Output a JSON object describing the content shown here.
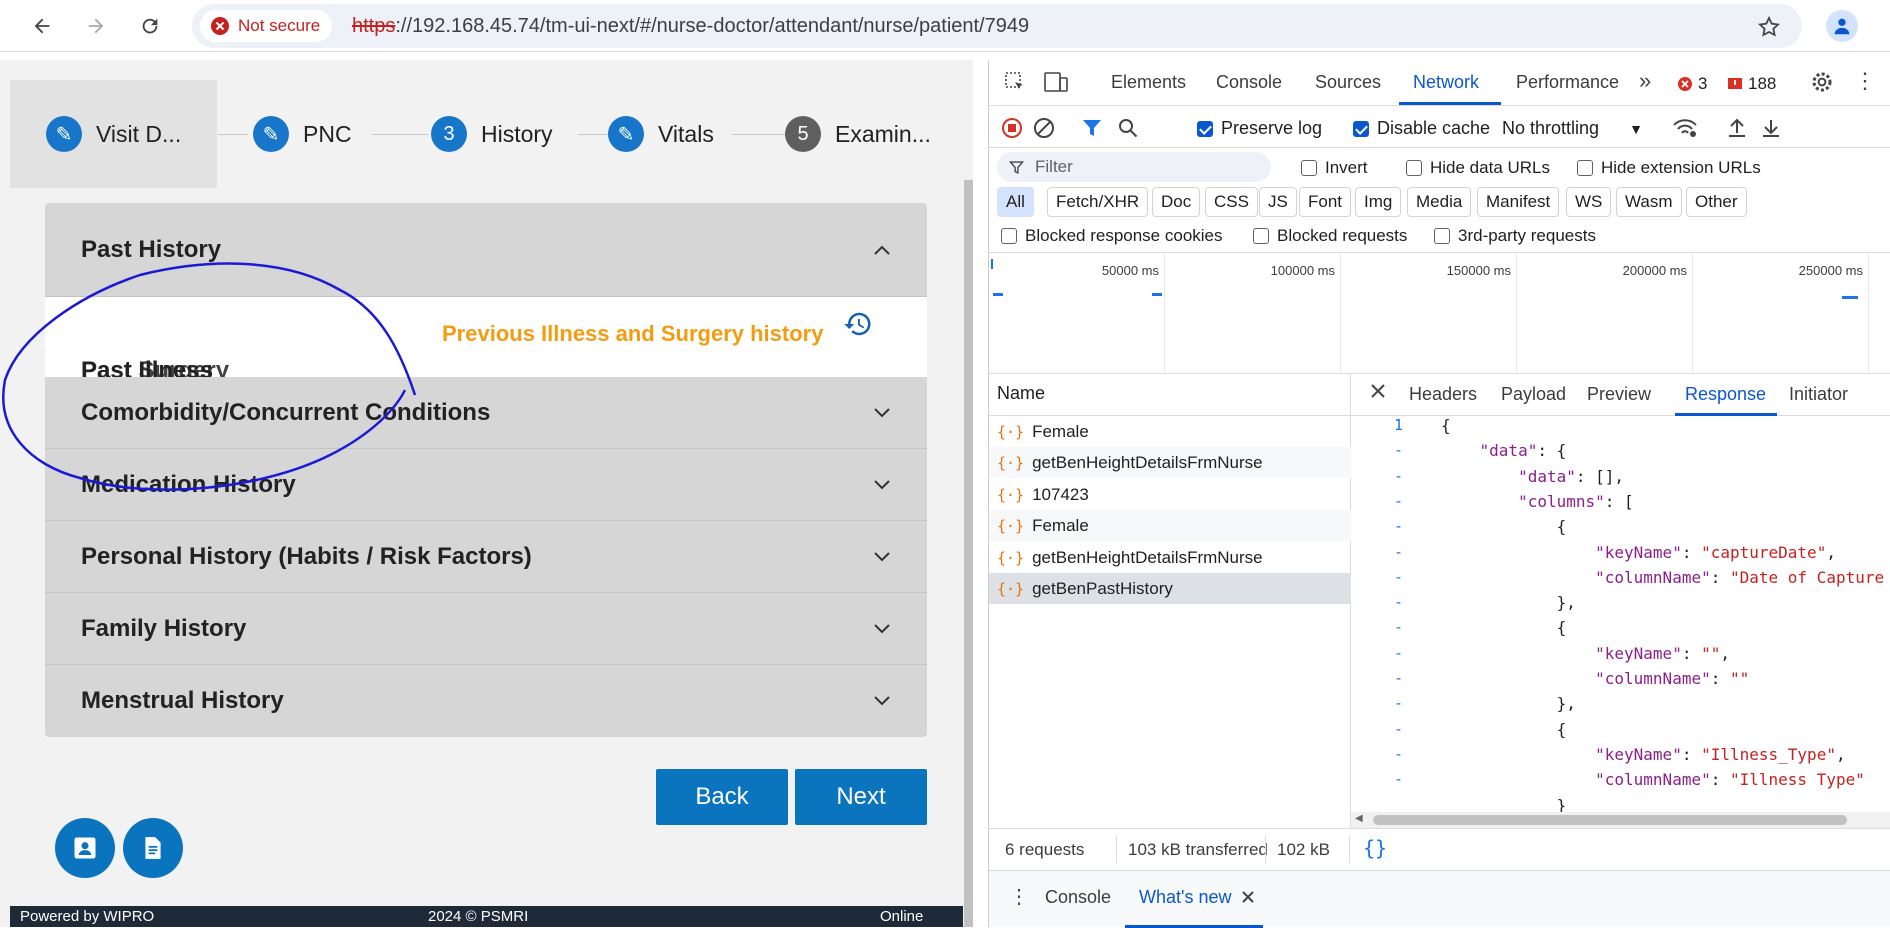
{
  "browser": {
    "security_label": "Not secure",
    "url_scheme": "https",
    "url_rest": "://192.168.45.74/tm-ui-next/#/nurse-doctor/attendant/nurse/patient/7949"
  },
  "stepper": {
    "steps": [
      {
        "label": "Visit D...",
        "badge": "✎"
      },
      {
        "label": "PNC",
        "badge": "✎"
      },
      {
        "label": "History",
        "badge": "3"
      },
      {
        "label": "Vitals",
        "badge": "✎"
      },
      {
        "label": "Examin...",
        "badge": "5"
      }
    ]
  },
  "accordion": {
    "past_history": "Past History",
    "previous_link": "Previous Illness and Surgery history",
    "overlap_text": "Past Illness",
    "overlap_text2": "Past Surgery",
    "sections": [
      "Comorbidity/Concurrent Conditions",
      "Medication History",
      "Personal History (Habits / Risk Factors)",
      "Family History",
      "Menstrual History"
    ]
  },
  "buttons": {
    "back": "Back",
    "next": "Next"
  },
  "footer": {
    "left": "Powered by WIPRO",
    "center": "2024 © PSMRI",
    "right": "Online"
  },
  "devtools": {
    "tabs": [
      "Elements",
      "Console",
      "Sources",
      "Network",
      "Performance"
    ],
    "errors": "3",
    "warnings": "188",
    "toolbar": {
      "preserve_log": "Preserve log",
      "disable_cache": "Disable cache",
      "throttling": "No throttling"
    },
    "filter_placeholder": "Filter",
    "filter_opts": [
      "Invert",
      "Hide data URLs",
      "Hide extension URLs"
    ],
    "chips": [
      "All",
      "Fetch/XHR",
      "Doc",
      "CSS",
      "JS",
      "Font",
      "Img",
      "Media",
      "Manifest",
      "WS",
      "Wasm",
      "Other"
    ],
    "blocked": [
      "Blocked response cookies",
      "Blocked requests",
      "3rd-party requests"
    ],
    "timeline_labels": [
      "50000 ms",
      "100000 ms",
      "150000 ms",
      "200000 ms",
      "250000 ms"
    ],
    "name_header": "Name",
    "requests": [
      "Female",
      "getBenHeightDetailsFrmNurse",
      "107423",
      "Female",
      "getBenHeightDetailsFrmNurse",
      "getBenPastHistory"
    ],
    "detail_tabs": [
      "Headers",
      "Payload",
      "Preview",
      "Response",
      "Initiator"
    ],
    "code_lines": [
      {
        "n": "1",
        "t": "{"
      },
      {
        "n": "-",
        "t": "    \"data\": {"
      },
      {
        "n": "-",
        "t": "        \"data\": [],"
      },
      {
        "n": "-",
        "t": "        \"columns\": ["
      },
      {
        "n": "-",
        "t": "            {"
      },
      {
        "n": "-",
        "t": "                \"keyName\": \"captureDate\","
      },
      {
        "n": "-",
        "t": "                \"columnName\": \"Date of Capture"
      },
      {
        "n": "-",
        "t": "            },"
      },
      {
        "n": "-",
        "t": "            {"
      },
      {
        "n": "-",
        "t": "                \"keyName\": \"\","
      },
      {
        "n": "-",
        "t": "                \"columnName\": \"\""
      },
      {
        "n": "-",
        "t": "            },"
      },
      {
        "n": "-",
        "t": "            {"
      },
      {
        "n": "-",
        "t": "                \"keyName\": \"Illness_Type\","
      },
      {
        "n": "-",
        "t": "                \"columnName\": \"Illness Type\""
      },
      {
        "n": "",
        "t": "            }"
      }
    ],
    "status": {
      "requests": "6 requests",
      "transferred": "103 kB transferred",
      "resources": "102 kB"
    },
    "drawer_tabs": [
      "Console",
      "What's new"
    ]
  }
}
